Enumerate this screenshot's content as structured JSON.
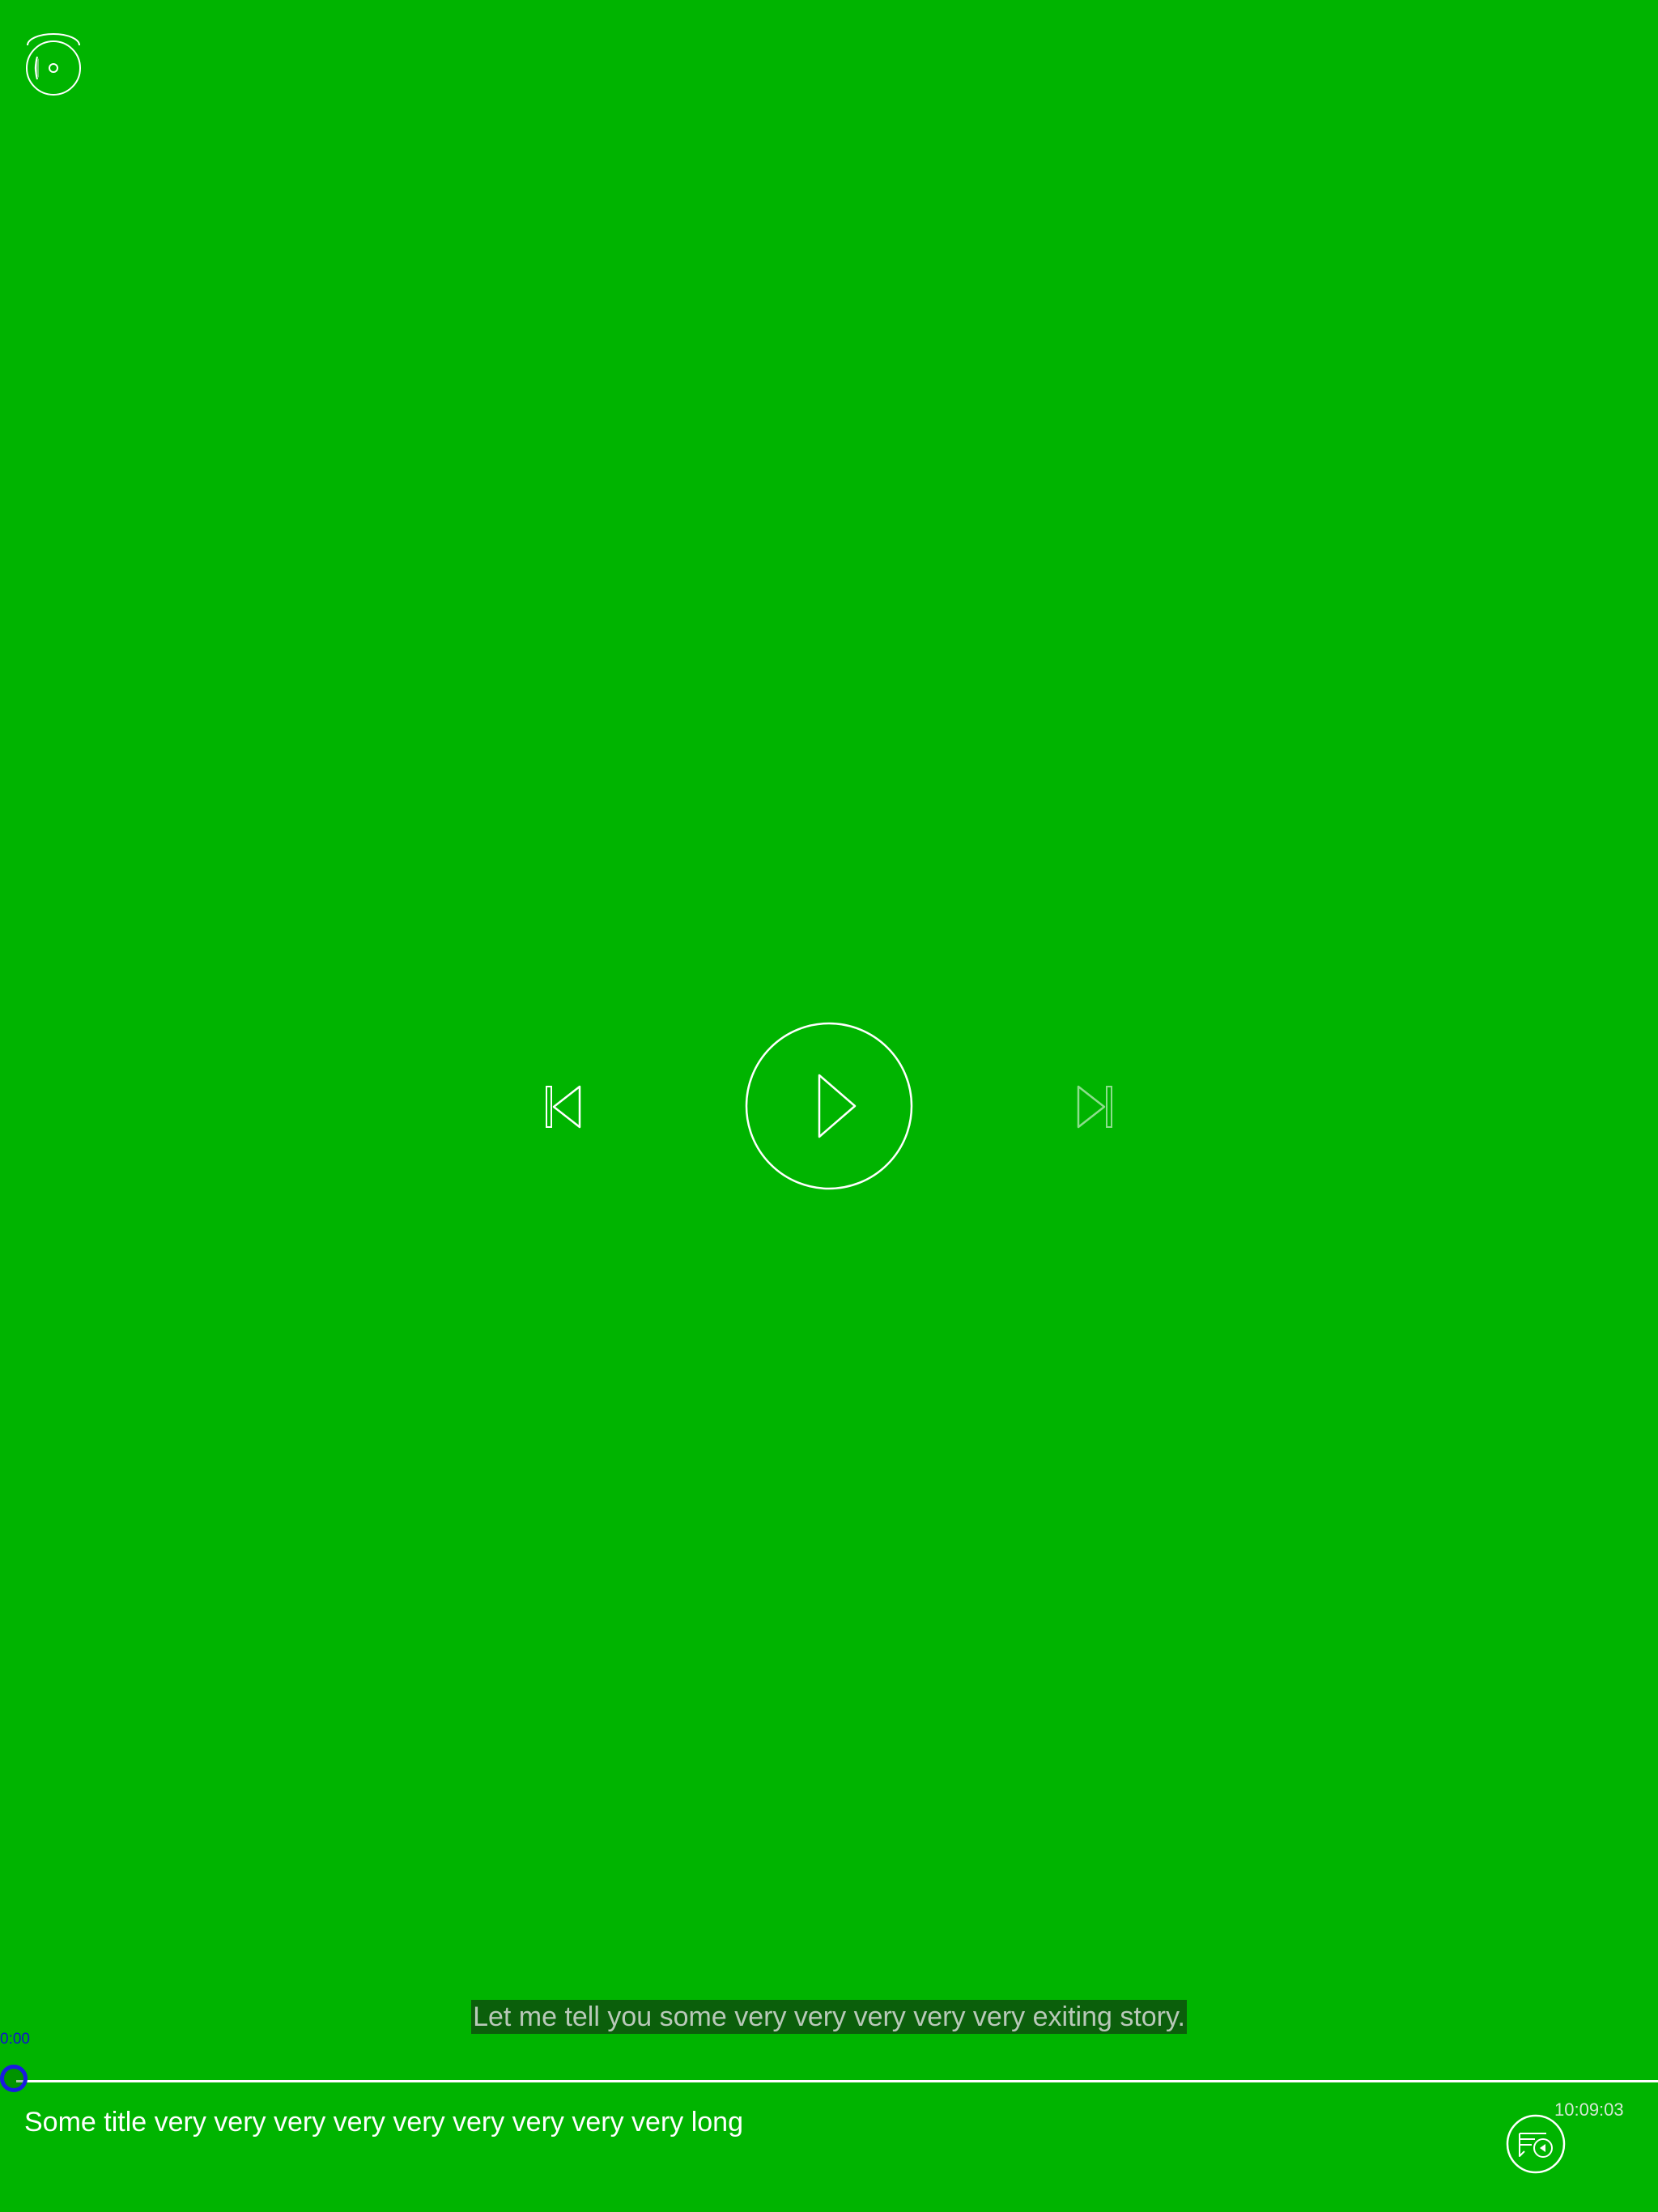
{
  "subtitle": {
    "text": "Let me tell you some very very very very very exiting story."
  },
  "player": {
    "elapsed": "0:00",
    "progress": 0,
    "title": "Some title very very very very very very very very very long",
    "clock": "10:09:03"
  },
  "icons": {
    "top_control": "video-settings-icon",
    "previous": "skip-previous-icon",
    "play": "play-icon",
    "next": "skip-next-icon",
    "audio": "audio-description-icon"
  },
  "colors": {
    "background": "#00b400",
    "foreground": "#ffffff",
    "knob_ring": "#1a1ae0",
    "subtitle_bg": "#0b5f0b"
  }
}
